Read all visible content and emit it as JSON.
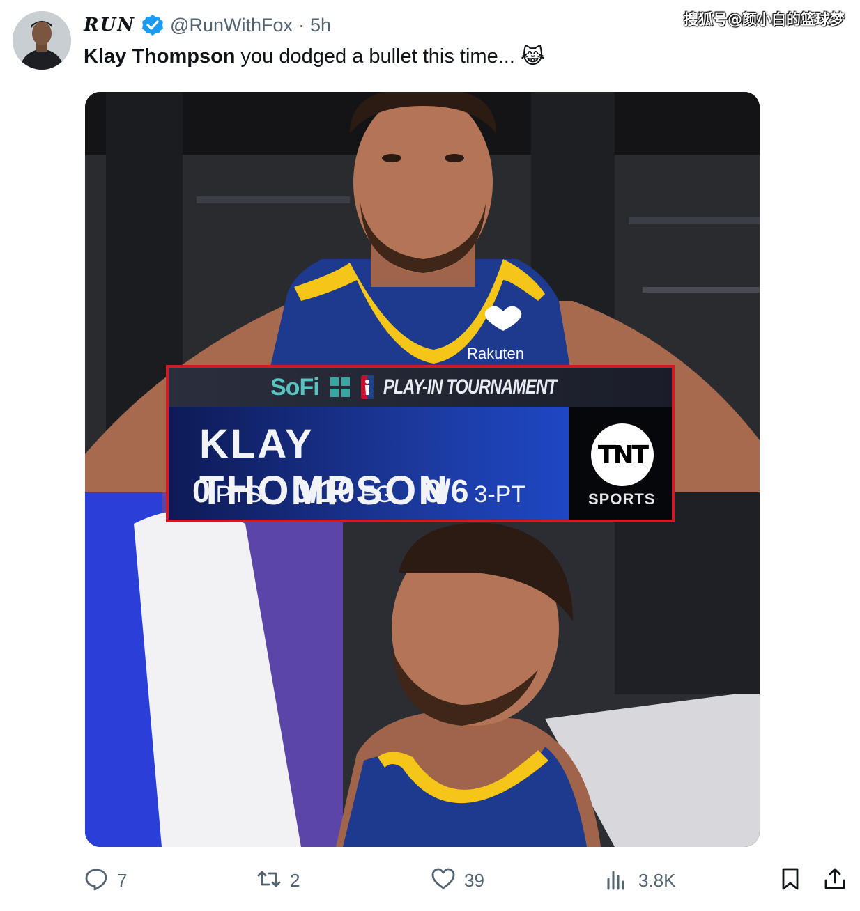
{
  "watermark": "搜狐号@颜小白的篮球梦",
  "tweet": {
    "author_name": "RUN",
    "handle": "@RunWithFox",
    "separator": "·",
    "time": "5h",
    "text_bold": "Klay Thompson",
    "text_rest": "you dodged a bullet this time...",
    "emoji": "😹"
  },
  "overlay": {
    "sponsor": "SoFi",
    "event": "PLAY-IN TOURNAMENT",
    "player": "KLAY THOMPSON",
    "stats": [
      {
        "value": "0",
        "label": "PTS"
      },
      {
        "value": "0/10",
        "label": "FG"
      },
      {
        "value": "0/6",
        "label": "3-PT"
      }
    ],
    "network": "TNT",
    "network_sub": "SPORTS",
    "jersey_sponsor": "Rakuten"
  },
  "actions": {
    "replies": "7",
    "reposts": "2",
    "likes": "39",
    "views": "3.8K"
  },
  "colors": {
    "verified": "#1d9bf0",
    "overlay_border": "#d11a25",
    "jersey_blue": "#1d3a8f",
    "jersey_gold": "#f5c518"
  }
}
